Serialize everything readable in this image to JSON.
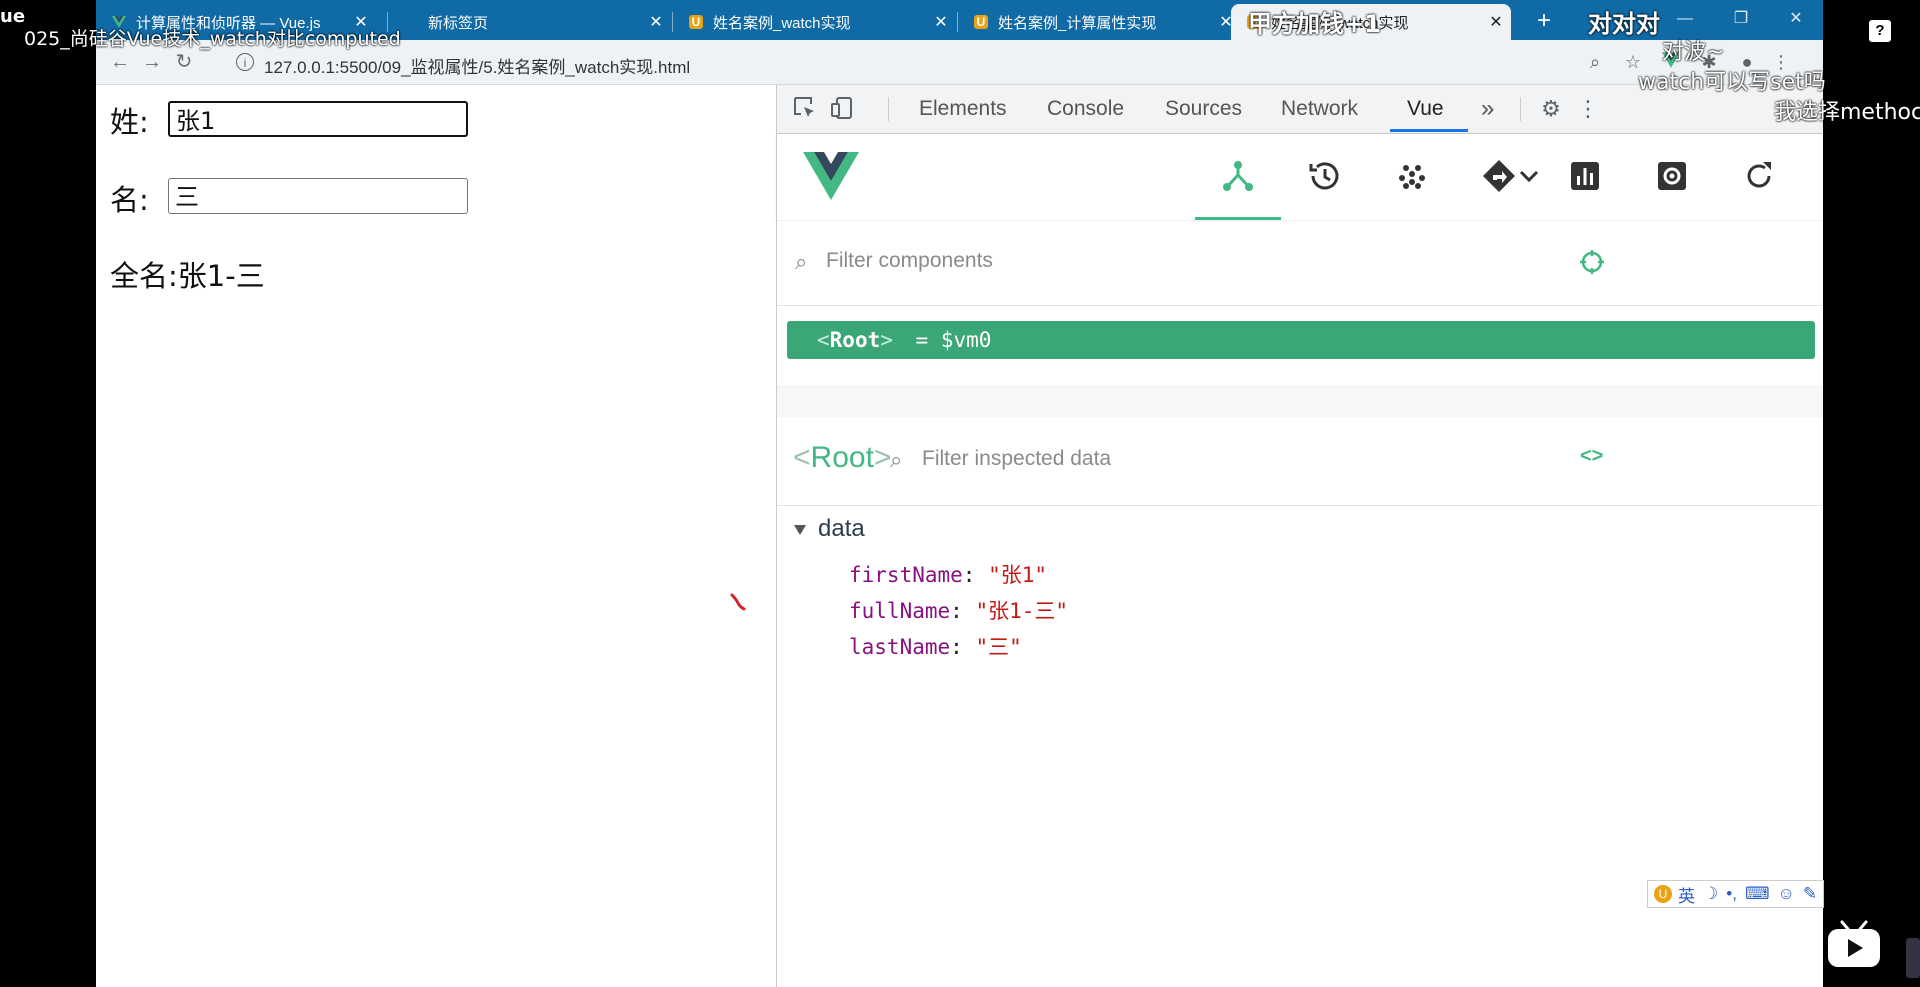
{
  "overlay": {
    "top_left_fragment": "ue",
    "video_title": "025_尚硅谷Vue技术_watch对比computed",
    "danmaku": [
      "对对对",
      "对波~",
      "watch可以写set吗",
      "我选择methoc",
      "甲方加钱+1"
    ]
  },
  "browser": {
    "tabs": [
      {
        "label": "计算属性和侦听器 — Vue.js",
        "icon": "vue-logo-icon",
        "active": false
      },
      {
        "label": "新标签页",
        "icon": "",
        "active": false
      },
      {
        "label": "姓名案例_watch实现",
        "icon": "html-file-icon",
        "active": false
      },
      {
        "label": "姓名案例_计算属性实现",
        "icon": "html-file-icon",
        "active": false
      },
      {
        "label": "姓名案例_watch实现",
        "icon": "html-file-icon",
        "active": true
      }
    ],
    "new_tab": "+",
    "window_controls": {
      "minimize": "—",
      "restore": "❐",
      "close": "✕"
    },
    "url": "127.0.0.1:5500/09_监视属性/5.姓名案例_watch实现.html"
  },
  "page": {
    "first_label": "姓:",
    "first_value": "张1",
    "last_label": "名:",
    "last_value": "三",
    "full_label": "全名:",
    "full_value": "张1-三"
  },
  "devtools": {
    "tabs": [
      "Elements",
      "Console",
      "Sources",
      "Network",
      "Vue"
    ],
    "active_tab": "Vue",
    "more": "»",
    "filter_components_placeholder": "Filter components",
    "root_row": {
      "open": "<",
      "name": "Root",
      "close": ">",
      "suffix": "= $vm0"
    },
    "inspected": {
      "open": "<",
      "name": "Root",
      "close": ">"
    },
    "filter_data_placeholder": "Filter inspected data",
    "code_toggle": "<>",
    "data_section": "data",
    "data": [
      {
        "key": "firstName",
        "value": "\"张1\""
      },
      {
        "key": "fullName",
        "value": "\"张1-三\""
      },
      {
        "key": "lastName",
        "value": "\"三\""
      }
    ],
    "vue_accent": "#42b883"
  },
  "ime": {
    "mode": "英"
  }
}
